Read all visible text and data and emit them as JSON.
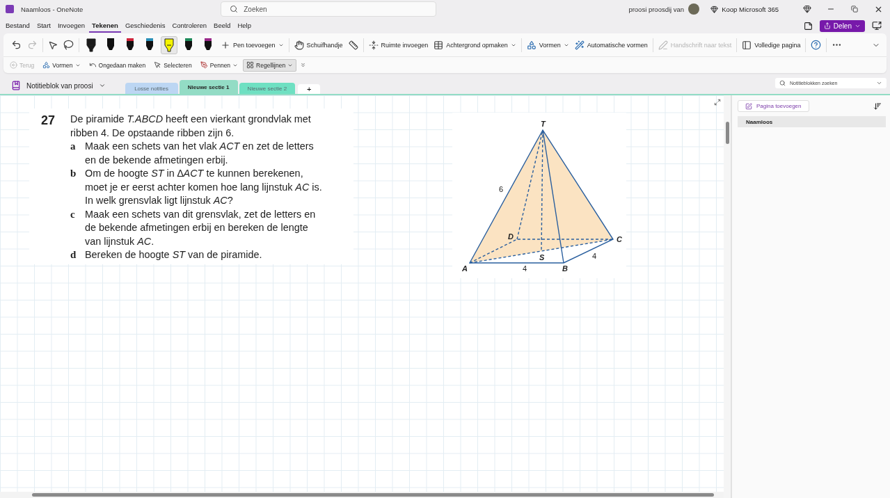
{
  "window": {
    "title": "Naamloos - OneNote",
    "search_placeholder": "Zoeken",
    "account": "proosi proosdij van",
    "buy": "Koop Microsoft 365"
  },
  "menu_tabs": [
    {
      "label": "Bestand",
      "selected": false
    },
    {
      "label": "Start",
      "selected": false
    },
    {
      "label": "Invoegen",
      "selected": false
    },
    {
      "label": "Tekenen",
      "selected": true
    },
    {
      "label": "Geschiedenis",
      "selected": false
    },
    {
      "label": "Controleren",
      "selected": false
    },
    {
      "label": "Beeld",
      "selected": false
    },
    {
      "label": "Help",
      "selected": false
    }
  ],
  "share_button": "Delen",
  "pens": [
    {
      "color": "#1a1a1a",
      "selected": false
    },
    {
      "color": "#111111",
      "selected": false
    },
    {
      "color": "#d0243a",
      "selected": false
    },
    {
      "color": "#2a8fb8",
      "selected": false
    },
    {
      "color": "#f5f500",
      "selected": true
    },
    {
      "color": "#1e8a5a",
      "selected": false
    },
    {
      "color": "#9b2a8a",
      "selected": false
    }
  ],
  "ribbon_buttons": [
    {
      "label": "Pen toevoegen",
      "dropdown": true,
      "disabled": false
    },
    {
      "label": "Schuifhandje",
      "dropdown": false,
      "disabled": false
    },
    {
      "label": "Ruimte invoegen",
      "dropdown": false,
      "disabled": false
    },
    {
      "label": "Achtergrond opmaken",
      "dropdown": true,
      "disabled": false
    },
    {
      "label": "Vormen",
      "dropdown": true,
      "disabled": false
    },
    {
      "label": "Automatische vormen",
      "dropdown": false,
      "disabled": false
    },
    {
      "label": "Handschrift naar tekst",
      "dropdown": false,
      "disabled": true
    },
    {
      "label": "Volledige pagina",
      "dropdown": false,
      "disabled": false
    }
  ],
  "quick_toolbar": [
    {
      "label": "Terug",
      "dropdown": false,
      "disabled": true,
      "selected": false
    },
    {
      "label": "Vormen",
      "dropdown": true,
      "disabled": false,
      "selected": false
    },
    {
      "label": "Ongedaan maken",
      "dropdown": false,
      "disabled": false,
      "selected": false
    },
    {
      "label": "Selecteren",
      "dropdown": false,
      "disabled": false,
      "selected": false
    },
    {
      "label": "Pennen",
      "dropdown": true,
      "disabled": false,
      "selected": false
    },
    {
      "label": "Regellijnen",
      "dropdown": true,
      "disabled": false,
      "selected": true
    }
  ],
  "notebook": {
    "name": "Notitieblok van proosi",
    "add_section": "+",
    "search_placeholder": "Notitieblokken zoeken"
  },
  "sections": [
    {
      "label": "Losse notities",
      "color": "#bcd6f3",
      "selected": false
    },
    {
      "label": "Nieuwe sectie 1",
      "color": "#93dcc5",
      "selected": true
    },
    {
      "label": "Nieuwe sectie 2",
      "color": "#6fe0c2",
      "selected": false
    }
  ],
  "exercise": {
    "number": "27",
    "intro": "De piramide *T.ABCD* heeft een vierkant grondvlak met ribben 4. De opstaande ribben zijn 6.",
    "parts": [
      {
        "letter": "a",
        "text": "Maak een schets van het vlak *ACT* en zet de letters en de bekende afmetingen erbij."
      },
      {
        "letter": "b",
        "text": "Om de hoogte *ST* in ∆*ACT* te kunnen berekenen, moet je er eerst achter komen hoe lang lijnstuk *AC* is.\nIn welk grensvlak ligt lijnstuk *AC*?"
      },
      {
        "letter": "c",
        "text": "Maak een schets van dit grensvlak, zet de letters en de bekende afmetingen erbij en bereken de lengte van lijnstuk *AC*."
      },
      {
        "letter": "d",
        "text": "Bereken de hoogte *ST* van de piramide."
      }
    ]
  },
  "figure": {
    "vertex_labels": [
      "T",
      "D",
      "C",
      "S",
      "A",
      "B"
    ],
    "edge_labels": [
      "6",
      "4",
      "4"
    ]
  },
  "pages_panel": {
    "add_page": "Pagina toevoegen",
    "pages": [
      {
        "title": "Naamloos",
        "selected": true
      }
    ]
  }
}
